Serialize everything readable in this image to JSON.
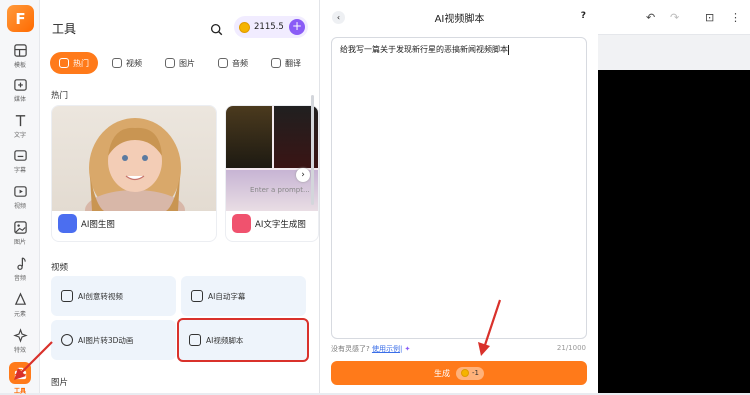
{
  "app": {
    "logo": "F"
  },
  "rail": {
    "items": [
      {
        "label": "模板",
        "icon": "template-icon"
      },
      {
        "label": "媒体",
        "icon": "media-icon"
      },
      {
        "label": "文字",
        "icon": "text-icon"
      },
      {
        "label": "字幕",
        "icon": "subtitle-icon"
      },
      {
        "label": "视频",
        "icon": "video-icon"
      },
      {
        "label": "图片",
        "icon": "image-icon"
      },
      {
        "label": "音频",
        "icon": "music-icon"
      },
      {
        "label": "元素",
        "icon": "element-icon"
      },
      {
        "label": "特效",
        "icon": "effect-icon"
      },
      {
        "label": "工具",
        "icon": "toolbox-icon"
      }
    ]
  },
  "panel": {
    "title": "工具",
    "coins": "2115.5",
    "tabs": [
      {
        "label": "热门"
      },
      {
        "label": "视频"
      },
      {
        "label": "图片"
      },
      {
        "label": "音频"
      },
      {
        "label": "翻译"
      }
    ],
    "sections": {
      "hot": "热门",
      "video": "视频",
      "image": "图片"
    },
    "cards": [
      {
        "label": "AI图生图"
      },
      {
        "label": "AI文字生成图"
      }
    ],
    "prompt_placeholder": "Enter a prompt...",
    "video_tools": [
      {
        "label": "AI创意转视频"
      },
      {
        "label": "AI自动字幕"
      },
      {
        "label": "AI图片转3D动画"
      },
      {
        "label": "AI视频脚本"
      }
    ]
  },
  "dialog": {
    "title": "AI视频脚本",
    "help": "?",
    "text": "给我写一篇关于发现新行星的恶搞新闻视频脚本",
    "hint": "没有灵感了?",
    "hint_link": "使用示例|",
    "count": "21/1000",
    "generate": "生成",
    "cost": "-1"
  },
  "colors": {
    "accent": "#ff7a1a",
    "coin_bg": "#f1ecff",
    "plus": "#8a5cf6",
    "annotation": "#d9312b"
  }
}
